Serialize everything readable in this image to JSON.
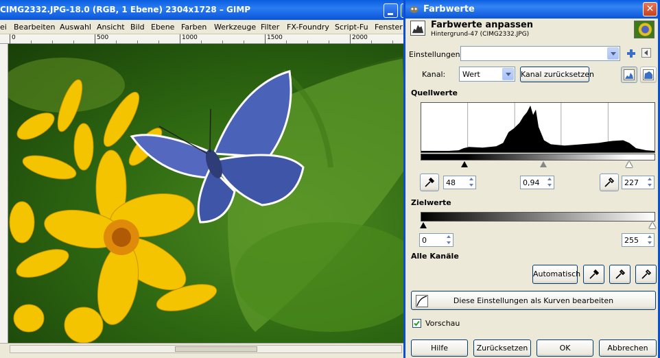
{
  "image_window": {
    "title": "CIMG2332.JPG-18.0 (RGB, 1 Ebene) 2304x1728 – GIMP",
    "menu": [
      "ei",
      "Bearbeiten",
      "Auswahl",
      "Ansicht",
      "Bild",
      "Ebene",
      "Farben",
      "Werkzeuge",
      "Filter",
      "FX-Foundry",
      "Script-Fu",
      "Fenster"
    ],
    "ruler_labels": [
      "0",
      "500",
      "1000",
      "1500",
      "2000"
    ]
  },
  "dialog": {
    "title": "Farbwerte",
    "close_label": "✕",
    "header_title": "Farbwerte anpassen",
    "header_subtitle": "Hintergrund-47 (CIMG2332.JPG)",
    "einstellungen_label": "Einstellungen:",
    "einstellungen_value": "",
    "kanal_label": "Kanal:",
    "kanal_value": "Wert",
    "reset_channel_button": "Kanal zurücksetzen",
    "quellwerte_label": "Quellwerte",
    "input_low": "48",
    "input_gamma": "0,94",
    "input_high": "227",
    "zielwerte_label": "Zielwerte",
    "output_low": "0",
    "output_high": "255",
    "alle_kanaele_label": "Alle Kanäle",
    "auto_button": "Automatisch",
    "curves_button": "Diese Einstellungen als Kurven bearbeiten",
    "vorschau_label": "Vorschau",
    "vorschau_checked": true,
    "buttons": {
      "hilfe": "Hilfe",
      "zuruecksetzen": "Zurücksetzen",
      "ok": "OK",
      "abbrechen": "Abbrechen"
    }
  },
  "levels": {
    "input_low_value": 48,
    "input_gamma_value": 0.94,
    "input_high_value": 227,
    "output_low_value": 0,
    "output_high_value": 255
  },
  "colors": {
    "xp_blue": "#0a5ee0",
    "dialog_bg": "#ece9d8"
  }
}
